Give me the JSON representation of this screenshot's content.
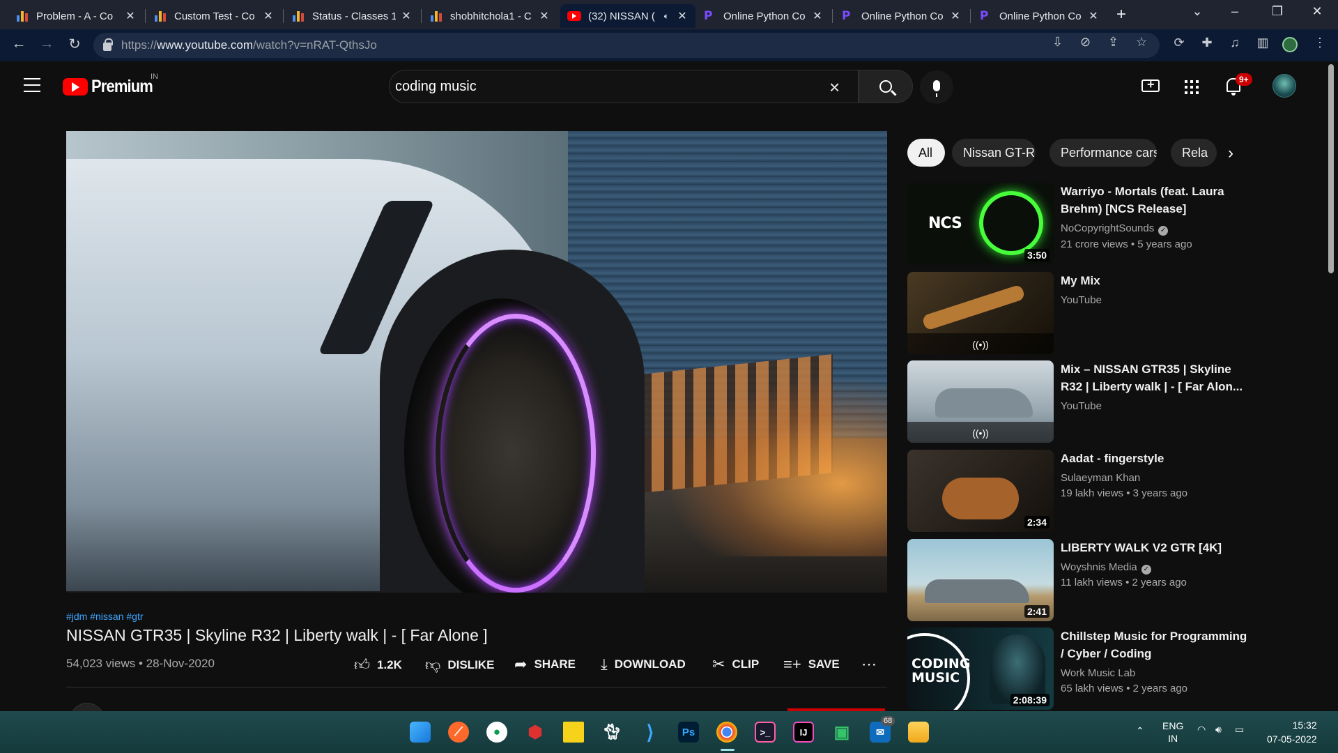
{
  "browser": {
    "tabs": [
      {
        "title": "Problem - A - Co",
        "favicon": "bar-chart-icon"
      },
      {
        "title": "Custom Test - Co",
        "favicon": "bar-chart-icon"
      },
      {
        "title": "Status - Classes 1",
        "favicon": "bar-chart-icon"
      },
      {
        "title": "shobhitchola1 - C",
        "favicon": "bar-chart-icon"
      },
      {
        "title": "(32) NISSAN (",
        "favicon": "youtube-icon"
      },
      {
        "title": "Online Python Co",
        "favicon": "programiz-icon"
      },
      {
        "title": "Online Python Co",
        "favicon": "programiz-icon"
      },
      {
        "title": "Online Python Co",
        "favicon": "programiz-icon"
      }
    ],
    "url_prefix": "https://",
    "url_host": "www.youtube.com",
    "url_path": "/watch?v=nRAT-QthsJo"
  },
  "youtube": {
    "logo_text": "Premium",
    "country_code": "IN",
    "search_value": "coding music",
    "notification_count": "9+"
  },
  "video": {
    "hashtags": "#jdm #nissan #gtr",
    "title": "NISSAN GTR35 | Skyline R32 | Liberty walk | - [ Far Alone ]",
    "views_date": "54,023 views • 28-Nov-2020",
    "actions": {
      "like": "1.2K",
      "dislike": "DISLIKE",
      "share": "SHARE",
      "download": "DOWNLOAD",
      "clip": "CLIP",
      "save": "SAVE"
    }
  },
  "chips": [
    "All",
    "Nissan GT-R",
    "Performance cars",
    "Rela"
  ],
  "recommendations": [
    {
      "title": "Warriyo - Mortals (feat. Laura Brehm) [NCS Release]",
      "channel": "NoCopyrightSounds",
      "verified": true,
      "meta": "21 crore views • 5 years ago",
      "duration": "3:50",
      "thumb_text": "NCS"
    },
    {
      "title": "My Mix",
      "channel": "YouTube",
      "verified": false,
      "meta": "",
      "duration": ""
    },
    {
      "title": "Mix – NISSAN GTR35 | Skyline R32 | Liberty walk | - [ Far Alon...",
      "channel": "YouTube",
      "verified": false,
      "meta": "",
      "duration": ""
    },
    {
      "title": "Aadat - fingerstyle",
      "channel": "Sulaeyman Khan",
      "verified": false,
      "meta": "19 lakh views • 3 years ago",
      "duration": "2:34"
    },
    {
      "title": "LIBERTY WALK V2 GTR [4K]",
      "channel": "Woyshnis Media",
      "verified": true,
      "meta": "11 lakh views • 2 years ago",
      "duration": "2:41"
    },
    {
      "title": "Chillstep Music for Programming / Cyber / Coding",
      "channel": "Work Music Lab",
      "verified": false,
      "meta": "65 lakh views • 2 years ago",
      "duration": "2:08:39",
      "thumb_text_1": "CODING",
      "thumb_text_2": "MUSIC"
    }
  ],
  "taskbar": {
    "language": "ENG",
    "region": "IN",
    "time": "15:32",
    "date": "07-05-2022",
    "mail_badge": "68"
  }
}
